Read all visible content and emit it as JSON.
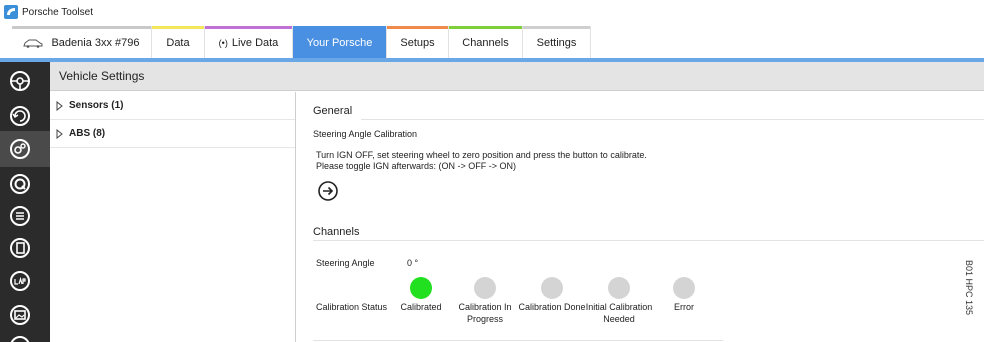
{
  "window": {
    "title": "Porsche Toolset"
  },
  "tabs": [
    {
      "label": "Badenia 3xx #796",
      "strip": "#c9c9c9",
      "icon": "car-icon"
    },
    {
      "label": "Data",
      "strip": "#f2e65a"
    },
    {
      "label": "Live Data",
      "strip": "#c071d6",
      "icon": "live-signal-icon",
      "icon_glyph": "(•)"
    },
    {
      "label": "Your Porsche",
      "strip": "#4a90e2",
      "active": true
    },
    {
      "label": "Setups",
      "strip": "#f08a4b"
    },
    {
      "label": "Channels",
      "strip": "#7fcf3c"
    },
    {
      "label": "Settings",
      "strip": "#cfcfcf"
    }
  ],
  "rail": {
    "icons": [
      "steering-wheel-icon",
      "refresh-icon",
      "vehicle-settings-icon",
      "q-icon",
      "list-icon",
      "pages-icon",
      "lap-icon",
      "image-icon",
      "more-icon"
    ],
    "active": "vehicle-settings-icon"
  },
  "header": {
    "title": "Vehicle Settings"
  },
  "tree": [
    {
      "label": "Sensors (1)"
    },
    {
      "label": "ABS (8)"
    }
  ],
  "general": {
    "title": "General",
    "subtitle": "Steering Angle Calibration",
    "line1": "Turn IGN OFF, set steering wheel to zero position and press the button to calibrate.",
    "line2": "Please toggle IGN afterwards: (ON -> OFF -> ON)",
    "button_icon": "arrow-right-circle-icon"
  },
  "channels": {
    "title": "Channels",
    "steering_angle_label": "Steering Angle",
    "steering_angle_value": "0 °",
    "calibration_status_label": "Calibration Status",
    "statuses": [
      {
        "label": "Calibrated",
        "active": true,
        "color": "#21e020"
      },
      {
        "label": "Calibration In Progress",
        "active": false
      },
      {
        "label": "Calibration Done",
        "active": false
      },
      {
        "label": "Initial Calibration Needed",
        "active": false
      },
      {
        "label": "Error",
        "active": false
      }
    ]
  },
  "side_text": "B01 HPC 135"
}
